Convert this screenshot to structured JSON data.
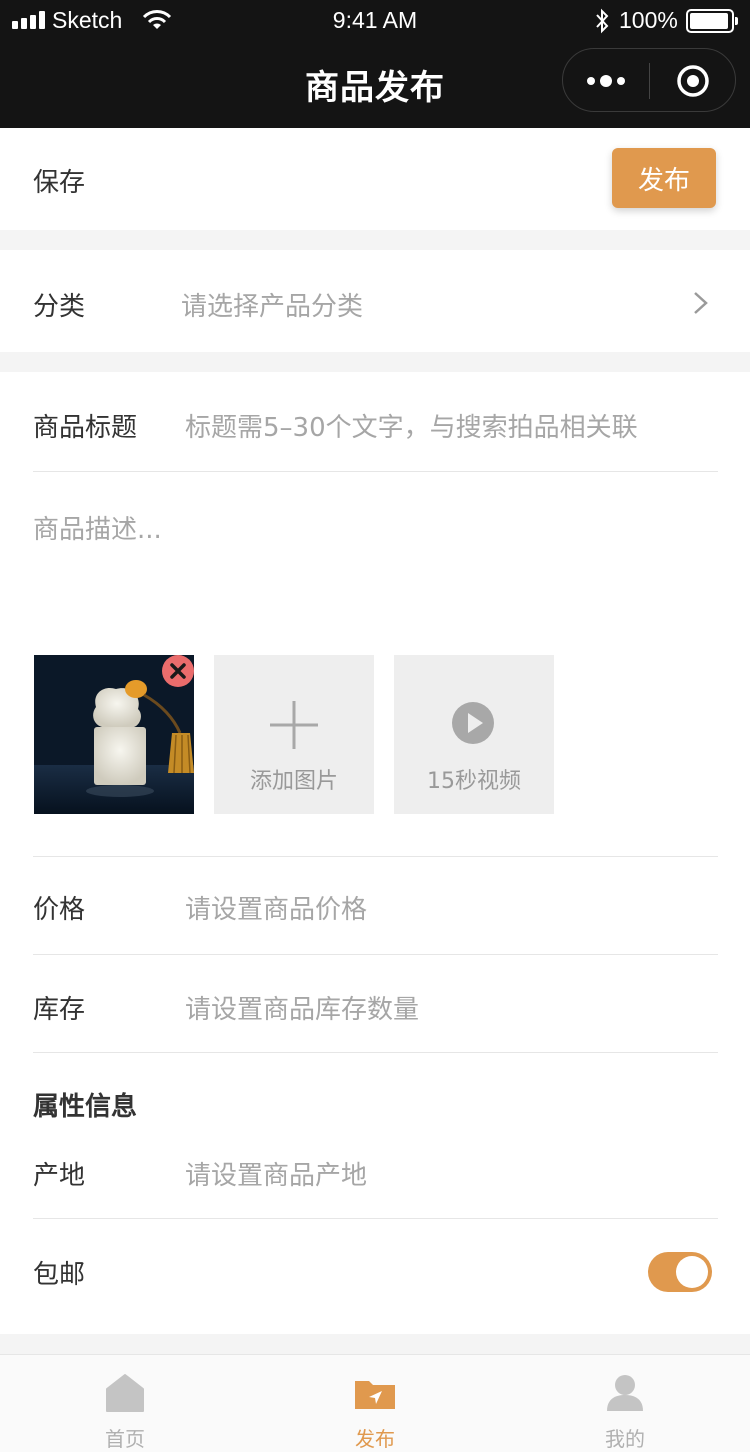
{
  "status_bar": {
    "carrier": "Sketch",
    "time": "9:41 AM",
    "battery": "100%"
  },
  "nav": {
    "title": "商品发布"
  },
  "toolbar": {
    "save_label": "保存",
    "publish_label": "发布"
  },
  "category": {
    "label": "分类",
    "placeholder": "请选择产品分类"
  },
  "title_field": {
    "label": "商品标题",
    "placeholder": "标题需5–30个文字，与搜索拍品相关联"
  },
  "description": {
    "placeholder": "商品描述..."
  },
  "media": {
    "add_image_label": "添加图片",
    "video_label": "15秒视频"
  },
  "price": {
    "label": "价格",
    "placeholder": "请设置商品价格"
  },
  "stock": {
    "label": "库存",
    "placeholder": "请设置商品库存数量"
  },
  "attributes": {
    "heading": "属性信息",
    "origin_label": "产地",
    "origin_placeholder": "请设置商品产地"
  },
  "shipping": {
    "label": "包邮",
    "enabled": true
  },
  "tabbar": {
    "items": [
      {
        "label": "首页",
        "active": false
      },
      {
        "label": "发布",
        "active": true
      },
      {
        "label": "我的",
        "active": false
      }
    ]
  },
  "colors": {
    "accent": "#e0994e",
    "topbar": "#141414",
    "placeholder": "#a6a6a6"
  }
}
